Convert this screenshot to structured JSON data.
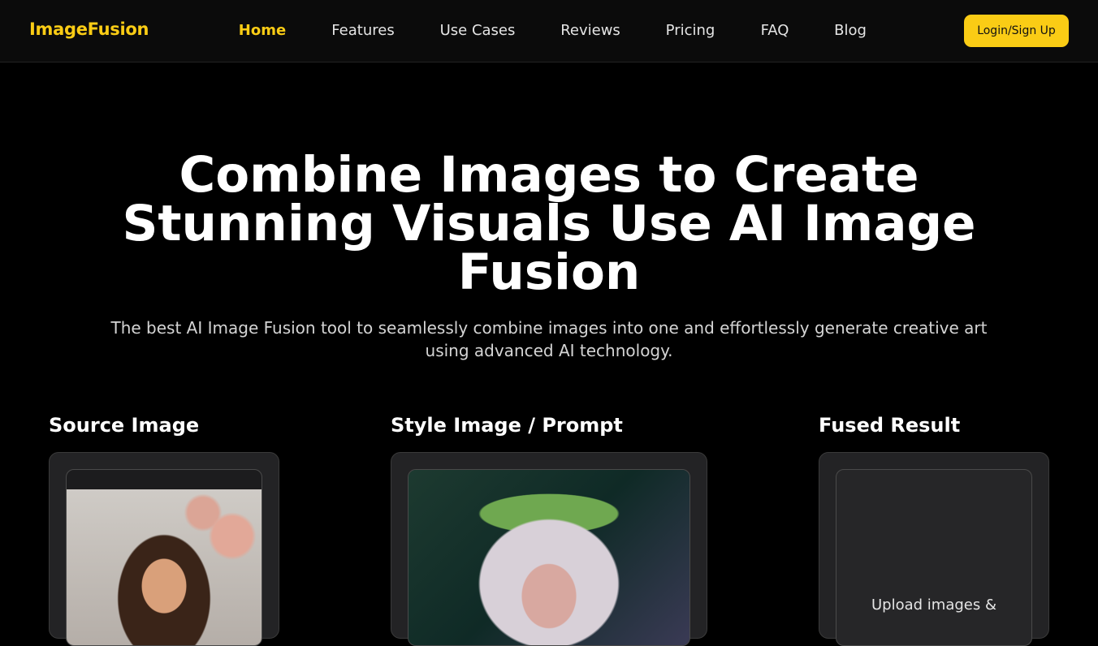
{
  "nav": {
    "logo": "ImageFusion",
    "links": [
      "Home",
      "Features",
      "Use Cases",
      "Reviews",
      "Pricing",
      "FAQ",
      "Blog"
    ],
    "active": "Home",
    "login_label": "Login/Sign Up"
  },
  "hero": {
    "title": "Combine Images to Create Stunning Visuals Use AI Image Fusion",
    "subtitle": "The best AI Image Fusion tool to seamlessly combine images into one and effortlessly generate creative art using advanced AI technology."
  },
  "columns": {
    "source": {
      "heading": "Source Image"
    },
    "style": {
      "heading": "Style Image / Prompt"
    },
    "result": {
      "heading": "Fused Result",
      "placeholder": "Upload images &"
    }
  },
  "colors": {
    "accent": "#facc15",
    "background": "#000000",
    "card": "#232325"
  }
}
